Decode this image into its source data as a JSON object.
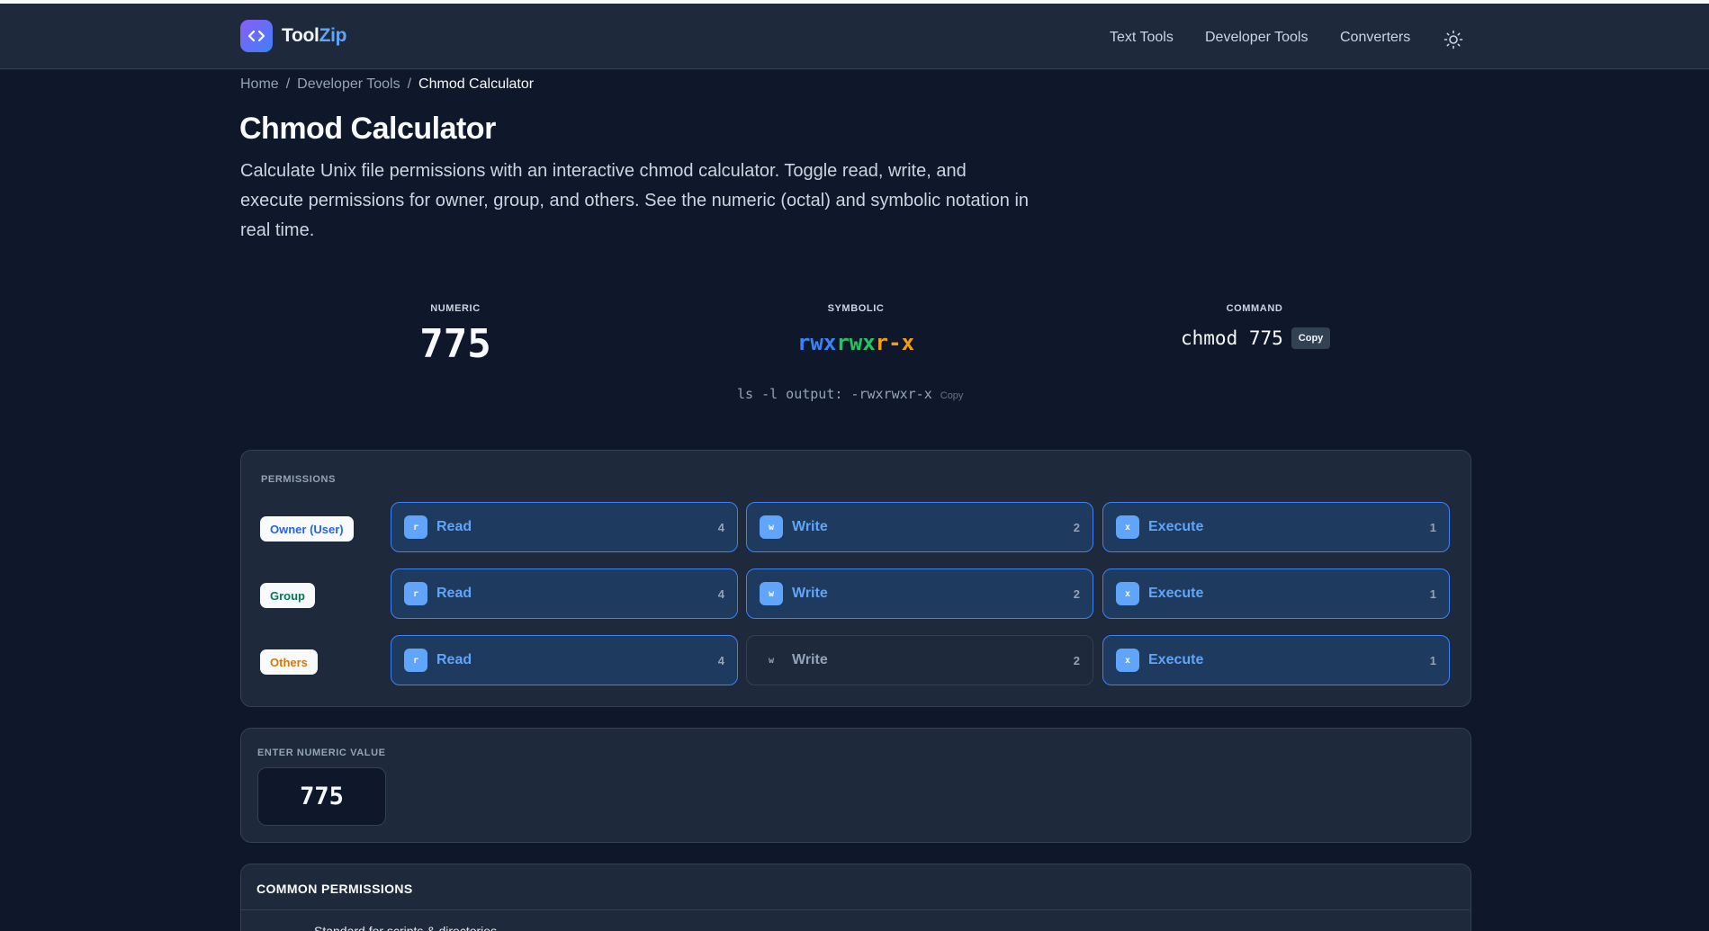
{
  "nav": {
    "logo_part1": "Tool",
    "logo_part2": "Zip",
    "links": [
      "Text Tools",
      "Developer Tools",
      "Converters"
    ],
    "theme_icon": "sun-icon"
  },
  "breadcrumb": {
    "home": "Home",
    "separator": "/",
    "section": "Developer Tools",
    "current": "Chmod Calculator"
  },
  "page": {
    "title": "Chmod Calculator",
    "description": "Calculate Unix file permissions with an interactive chmod calculator. Toggle read, write, and execute permissions for owner, group, and others. See the numeric (octal) and symbolic notation in real time."
  },
  "result": {
    "numeric_label": "NUMERIC",
    "numeric_value": "775",
    "symbolic_label": "SYMBOLIC",
    "symbolic_owner": "rwx",
    "symbolic_group": "rwx",
    "symbolic_others": "r-x",
    "command_label": "COMMAND",
    "command_value": "chmod 775",
    "copy_label": "Copy",
    "ls_output": "ls -l output: -rwxrwxr-x",
    "ls_copy_label": "Copy"
  },
  "permissions": {
    "label": "PERMISSIONS",
    "roles": [
      {
        "name": "Owner (User)",
        "color": "#2563eb",
        "perms": [
          {
            "icon": "r",
            "label": "Read",
            "value": "4",
            "enabled": true
          },
          {
            "icon": "w",
            "label": "Write",
            "value": "2",
            "enabled": true
          },
          {
            "icon": "x",
            "label": "Execute",
            "value": "1",
            "enabled": true
          }
        ]
      },
      {
        "name": "Group",
        "color": "#047857",
        "perms": [
          {
            "icon": "r",
            "label": "Read",
            "value": "4",
            "enabled": true
          },
          {
            "icon": "w",
            "label": "Write",
            "value": "2",
            "enabled": true
          },
          {
            "icon": "x",
            "label": "Execute",
            "value": "1",
            "enabled": true
          }
        ]
      },
      {
        "name": "Others",
        "color": "#d97706",
        "perms": [
          {
            "icon": "r",
            "label": "Read",
            "value": "4",
            "enabled": true
          },
          {
            "icon": "w",
            "label": "Write",
            "value": "2",
            "enabled": false
          },
          {
            "icon": "x",
            "label": "Execute",
            "value": "1",
            "enabled": true
          }
        ]
      }
    ]
  },
  "numeric_input": {
    "label": "ENTER NUMERIC VALUE",
    "value": "775"
  },
  "common": {
    "title": "COMMON PERMISSIONS",
    "first_item": "Standard for scripts & directories"
  },
  "colors": {
    "background": "#0f172a",
    "panel": "#1e293b",
    "accent": "#3b82f6",
    "symbolic_owner": "#3b82f6",
    "symbolic_group": "#22c55e",
    "symbolic_others": "#f59e0b"
  }
}
